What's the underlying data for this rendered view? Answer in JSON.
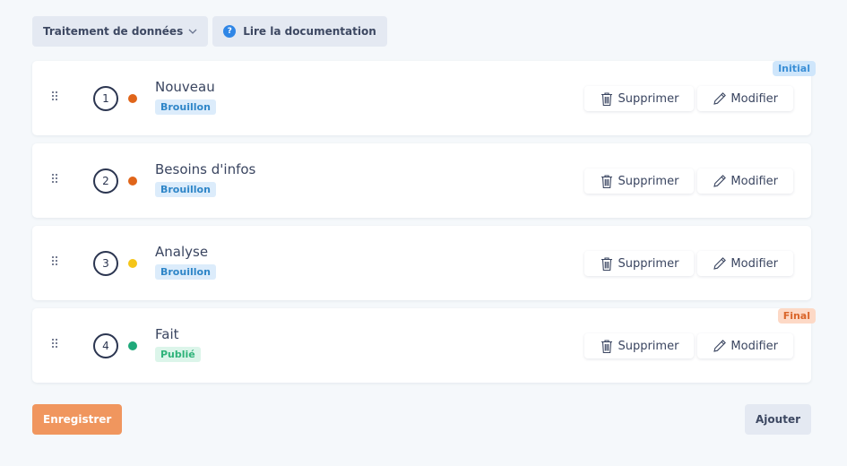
{
  "toolbar": {
    "dropdown_label": "Traitement de données",
    "docs_label": "Lire la documentation",
    "help_glyph": "?"
  },
  "colors": {
    "accent": "#f0965e",
    "dot_orange": "#e0651a",
    "dot_yellow": "#f5c518",
    "dot_green": "#1fa97a",
    "badge_draft": "#2f86c8",
    "badge_published": "#2fb37a"
  },
  "states": [
    {
      "number": "1",
      "name": "Nouveau",
      "badge": "Brouillon",
      "dot_color": "#e0651a",
      "corner": "Initial"
    },
    {
      "number": "2",
      "name": "Besoins d'infos",
      "badge": "Brouillon",
      "dot_color": "#e0651a",
      "corner": ""
    },
    {
      "number": "3",
      "name": "Analyse",
      "badge": "Brouillon",
      "dot_color": "#f5c518",
      "corner": ""
    },
    {
      "number": "4",
      "name": "Fait",
      "badge": "Publié",
      "dot_color": "#1fa97a",
      "corner": "Final"
    }
  ],
  "actions": {
    "delete_label": "Supprimer",
    "delete_icon": "trash-icon",
    "edit_label": "Modifier",
    "edit_icon": "pencil-icon"
  },
  "footer": {
    "save_label": "Enregistrer",
    "add_label": "Ajouter"
  }
}
